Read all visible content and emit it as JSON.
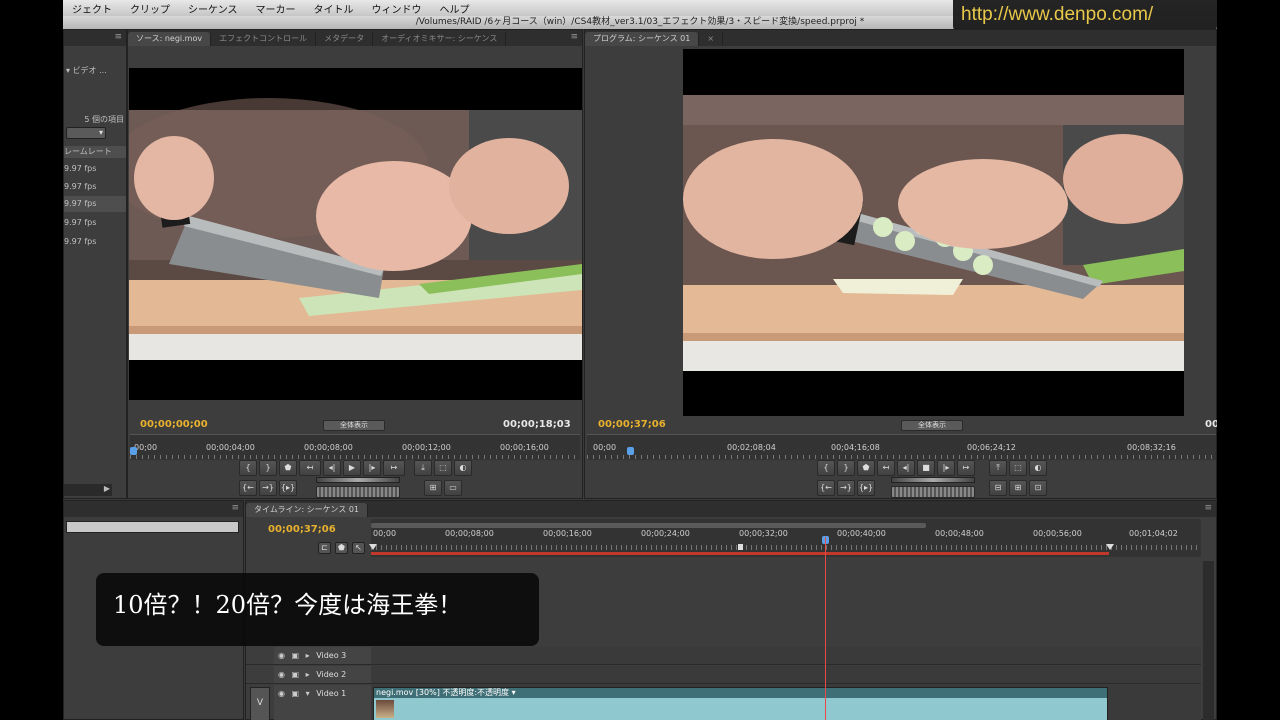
{
  "menubar": {
    "items": [
      "ジェクト",
      "クリップ",
      "シーケンス",
      "マーカー",
      "タイトル",
      "ウィンドウ",
      "ヘルプ"
    ]
  },
  "window": {
    "title": "/Volumes/RAID /6ヶ月コース（win）/CS4教材_ver3.1/03_エフェクト効果/3・スピード変換/speed.prproj *"
  },
  "watermark": {
    "url": "http://www.denpo.com/"
  },
  "project": {
    "label_video": "▾ ビデオ ...",
    "items_count": "5 個の項目",
    "column_header": "レームレート",
    "rows": [
      "9.97 fps",
      "9.97 fps",
      "9.97 fps",
      "9.97 fps",
      "9.97 fps"
    ],
    "scroll_arrow": "▶"
  },
  "source": {
    "tabs": [
      "ソース: negi.mov",
      "エフェクトコントロール",
      "メタデータ",
      "オーディオミキサー: シーケンス"
    ],
    "current_tc": "00;00;00;00",
    "duration_tc": "00;00;18;03",
    "fit": "全体表示",
    "ticks": [
      "00;00",
      "00;00;04;00",
      "00;00;08;00",
      "00;00;12;00",
      "00;00;16;00"
    ]
  },
  "program": {
    "tabs": [
      "プログラム: シーケンス 01"
    ],
    "current_tc": "00;00;37;06",
    "duration_tc": "00",
    "fit": "全体表示",
    "ticks": [
      "00;00",
      "00;02;08;04",
      "00;04;16;08",
      "00;06;24;12",
      "00;08;32;16"
    ]
  },
  "timeline": {
    "tab": "タイムライン: シーケンス 01",
    "current_tc": "00;00;37;06",
    "ticks": [
      "00;00",
      "00;00;08;00",
      "00;00;16;00",
      "00;00;24;00",
      "00;00;32;00",
      "00;00;40;00",
      "00;00;48;00",
      "00;00;56;00",
      "00;01;04;02"
    ],
    "tracks": [
      "Video 3",
      "Video 2",
      "Video 1"
    ],
    "target_label": "V",
    "clip_label": "negi.mov [30%]  不透明度:不透明度 ▾"
  },
  "caption": {
    "text": "10倍？！20倍？今度は海王拳！"
  },
  "colors": {
    "timecode_accent": "#e8b12e",
    "playhead": "#e84a4a",
    "clip": "#8fc8cf"
  }
}
